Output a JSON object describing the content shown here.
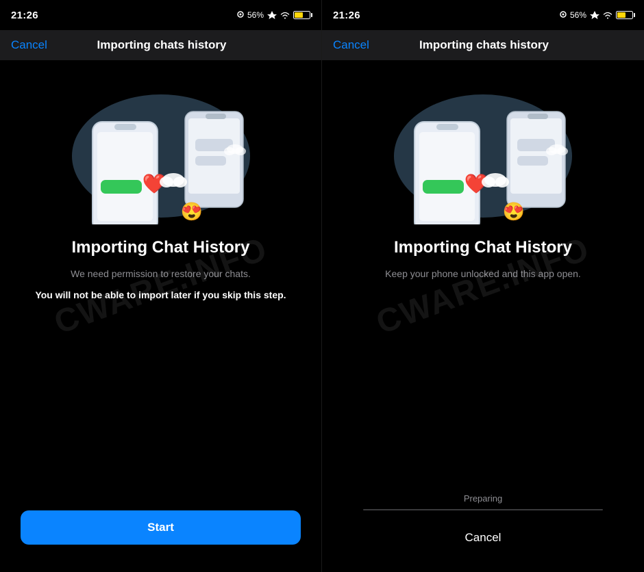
{
  "left_screen": {
    "status_bar": {
      "time": "21:26",
      "battery_percent": "56%",
      "wifi": true,
      "signal": true,
      "airplane": true
    },
    "nav": {
      "cancel_label": "Cancel",
      "title": "Importing chats history"
    },
    "content": {
      "heading": "Importing Chat History",
      "description": "We need permission to restore your chats.",
      "warning": "You will not be able to import later if you skip this step.",
      "start_button_label": "Start"
    },
    "watermark": "CWARE.INFO"
  },
  "right_screen": {
    "status_bar": {
      "time": "21:26",
      "battery_percent": "56%",
      "wifi": true,
      "signal": true,
      "airplane": true
    },
    "nav": {
      "cancel_label": "Cancel",
      "title": "Importing chats history"
    },
    "content": {
      "heading": "Importing Chat History",
      "description": "Keep your phone unlocked and this app open.",
      "progress_label": "Preparing",
      "progress_value": 0,
      "cancel_button_label": "Cancel"
    },
    "watermark": "CWARE.INFO"
  }
}
